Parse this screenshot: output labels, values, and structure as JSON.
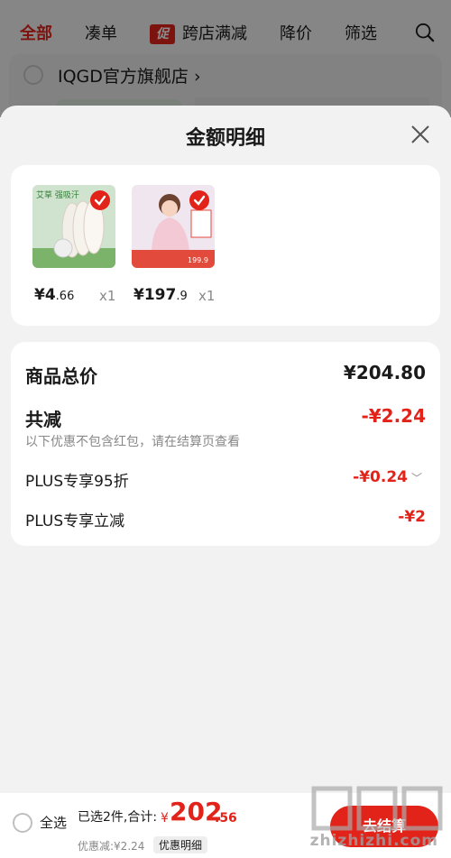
{
  "top_tabs": [
    {
      "label": "全部",
      "active": true
    },
    {
      "label": "凑单",
      "active": false
    },
    {
      "label": "跨店满减",
      "active": false,
      "badge": "促"
    },
    {
      "label": "降价",
      "active": false
    },
    {
      "label": "筛选",
      "active": false
    }
  ],
  "store": {
    "name": "IQGD官方旗舰店 ›"
  },
  "sheet": {
    "title": "金额明细"
  },
  "products": [
    {
      "price_int": "¥4",
      "price_dec": ".66",
      "qty": "x1",
      "thumb_text": "艾草 强吸汗"
    },
    {
      "price_int": "¥197",
      "price_dec": ".9",
      "qty": "x1",
      "thumb_text": "199.9"
    }
  ],
  "totals": {
    "total_label": "商品总价",
    "total_value": "¥204.80",
    "reduce_label": "共减",
    "reduce_value": "-¥2.24",
    "note": "以下优惠不包含红包，请在结算页查看",
    "plus_discount_label": "PLUS专享95折",
    "plus_discount_value": "-¥0.24",
    "plus_reduce_label": "PLUS专享立减",
    "plus_reduce_value": "-¥2"
  },
  "bottom": {
    "select_all": "全选",
    "summary": "已选2件,合计:",
    "currency": "¥",
    "amount_int": "202",
    "amount_dec": ".56",
    "discount": "优惠减:¥2.24",
    "detail_link": "优惠明细",
    "checkout": "去结算"
  },
  "watermark": {
    "text": "zhizhizhi.com",
    "logo": "值值值"
  },
  "colors": {
    "accent": "#e2231a"
  }
}
